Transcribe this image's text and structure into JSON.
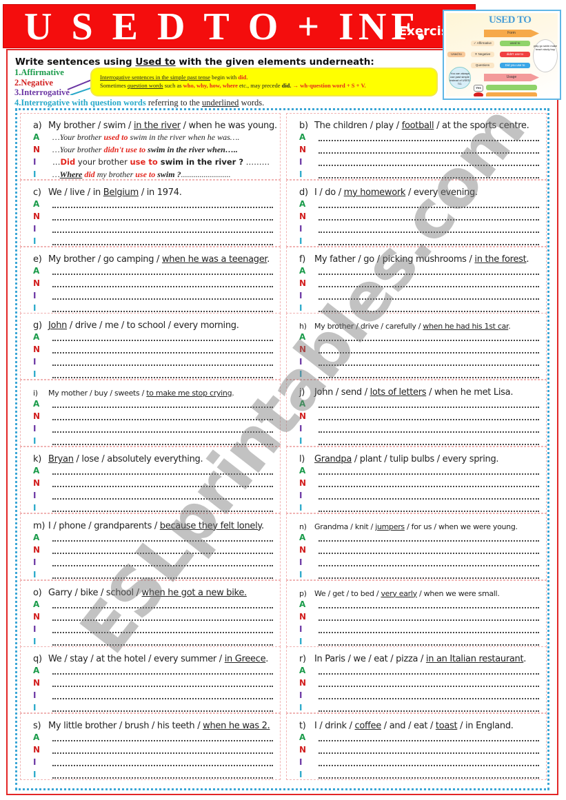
{
  "header": {
    "title": "U S E D  T O + INF.",
    "subtitle": "Exercises"
  },
  "thumbnail": {
    "title": "USED TO",
    "form_label": "Form",
    "usage_label": "Usage",
    "root_label": "Used to",
    "branches": [
      "✓ Affirmative",
      "✕ Negative",
      "Questions"
    ],
    "forms": [
      "used to",
      "didn't use to",
      "Did you use to"
    ],
    "verbs": "play go swim make teach study buy",
    "side_note": "You can always use past simple instead of USED TO.",
    "yes_label": "Yes",
    "no_label": "No",
    "colors": {
      "border": "#5fb6e6",
      "arrow": "#f6a94a",
      "green": "#8fd36a",
      "red": "#f04040",
      "blue": "#3aa6e6"
    }
  },
  "instructions": {
    "prefix": "Write sentences using ",
    "keyword": "Used to",
    "suffix": " with the given elements underneath:",
    "types": {
      "affirmative": "1.Affirmative",
      "negative": "2.Negative",
      "interrogative": "3.Interrogative",
      "question_words_label": "4.Interrogative with question words",
      "question_words_rest_a": " referring to the ",
      "question_words_underlined": "underlined",
      "question_words_rest_b": " words."
    }
  },
  "note": {
    "line1_underlined": "Interrogative sentences in the simple past tense",
    "line1_rest": " begin with ",
    "line1_red": "did",
    "line1_end": ".",
    "line2_a": "Sometimes ",
    "line2_underlined": "question words",
    "line2_b": " such as ",
    "line2_red": "who, why, how, where",
    "line2_c": " etc., may precede ",
    "line2_bold": "did.",
    "line2_formula": "  → wh-question word + S + V."
  },
  "line_labels": {
    "a": "A",
    "n": "N",
    "i1": "I",
    "i2": "I"
  },
  "example": {
    "a_pre": "…Your brother ",
    "a_red": "used to",
    "a_post": "  swim in the river when he was….",
    "n_pre": "…Your brother ",
    "n_red": "didn't use to",
    "n_post": " swim in the river when…..",
    "i_pre": "…",
    "i_red1": "Did",
    "i_mid": " your brother ",
    "i_red2": "use to",
    "i_bold": " swim in the river ?",
    "i_post": " ………",
    "q_pre": "…",
    "q_where": "Where",
    "q_did": " did",
    "q_mid": " my brother ",
    "q_red": "use to",
    "q_bold": " swim ?",
    "q_post": "........................"
  },
  "exercises": [
    {
      "letter": "a)",
      "parts": [
        [
          "My brother / swim / ",
          false
        ],
        [
          "in the river",
          true
        ],
        [
          " / when he was young.",
          false
        ]
      ],
      "small": false
    },
    {
      "letter": "b)",
      "parts": [
        [
          "The children / play / ",
          false
        ],
        [
          "football",
          true
        ],
        [
          " / at the sports centre.",
          false
        ]
      ],
      "small": false
    },
    {
      "letter": "c)",
      "parts": [
        [
          "We / live / in ",
          false
        ],
        [
          "Belgium",
          true
        ],
        [
          " / in 1974.",
          false
        ]
      ],
      "small": false
    },
    {
      "letter": "d)",
      "parts": [
        [
          "I / do / ",
          false
        ],
        [
          "my homework",
          true
        ],
        [
          " / every evening.",
          false
        ]
      ],
      "small": false
    },
    {
      "letter": "e)",
      "parts": [
        [
          "My brother / go camping / ",
          false
        ],
        [
          "when he was a teenager",
          true
        ],
        [
          ".",
          false
        ]
      ],
      "small": false
    },
    {
      "letter": "f)",
      "parts": [
        [
          "My father / go / picking mushrooms / ",
          false
        ],
        [
          "in the forest",
          true
        ],
        [
          ".",
          false
        ]
      ],
      "small": false
    },
    {
      "letter": "g)",
      "parts": [
        [
          "John",
          true
        ],
        [
          " / drive / me / to school / every morning.",
          false
        ]
      ],
      "small": false
    },
    {
      "letter": "h)",
      "parts": [
        [
          "My brother / drive / carefully / ",
          false
        ],
        [
          "when he had his 1st car",
          true
        ],
        [
          ".",
          false
        ]
      ],
      "small": true
    },
    {
      "letter": "i)",
      "parts": [
        [
          "My mother / buy / sweets / ",
          false
        ],
        [
          "to make me stop crying",
          true
        ],
        [
          ".",
          false
        ]
      ],
      "small": true
    },
    {
      "letter": "j)",
      "parts": [
        [
          "John / send / ",
          false
        ],
        [
          "lots of letters",
          true
        ],
        [
          " / when he met Lisa.",
          false
        ]
      ],
      "small": false
    },
    {
      "letter": "k)",
      "parts": [
        [
          "Bryan",
          true
        ],
        [
          " / lose / absolutely everything.",
          false
        ]
      ],
      "small": false
    },
    {
      "letter": "l)",
      "parts": [
        [
          "Grandpa",
          true
        ],
        [
          " / plant / tulip bulbs / every spring.",
          false
        ]
      ],
      "small": false
    },
    {
      "letter": "m)",
      "parts": [
        [
          "I / phone / grandparents / ",
          false
        ],
        [
          "because they felt lonely",
          true
        ],
        [
          ".",
          false
        ]
      ],
      "small": false
    },
    {
      "letter": "n)",
      "parts": [
        [
          "Grandma / knit / ",
          false
        ],
        [
          "jumpers",
          true
        ],
        [
          " / for us / when we were young.",
          false
        ]
      ],
      "small": true
    },
    {
      "letter": "o)",
      "parts": [
        [
          "Garry / bike / school / ",
          false
        ],
        [
          "when he got a new bike.",
          true
        ]
      ],
      "small": false
    },
    {
      "letter": "p)",
      "parts": [
        [
          "We / get / to bed / ",
          false
        ],
        [
          "very early",
          true
        ],
        [
          " / when we were small.",
          false
        ]
      ],
      "small": true
    },
    {
      "letter": "q)",
      "parts": [
        [
          "We / stay / at the hotel / every summer / ",
          false
        ],
        [
          "in Greece",
          true
        ],
        [
          ".",
          false
        ]
      ],
      "small": false
    },
    {
      "letter": "r)",
      "parts": [
        [
          "In Paris / we / eat / pizza / ",
          false
        ],
        [
          "in an Italian restaurant",
          true
        ],
        [
          ".",
          false
        ]
      ],
      "small": false
    },
    {
      "letter": "s)",
      "parts": [
        [
          "My little brother / brush / his teeth / ",
          false
        ],
        [
          "when he was 2.",
          true
        ]
      ],
      "small": false
    },
    {
      "letter": "t)",
      "parts": [
        [
          "I / drink / ",
          false
        ],
        [
          "coffee",
          true
        ],
        [
          " / and / eat / ",
          false
        ],
        [
          "toast",
          true
        ],
        [
          " / in England.",
          false
        ]
      ],
      "small": false
    }
  ],
  "watermark": "ESLprintables.com"
}
